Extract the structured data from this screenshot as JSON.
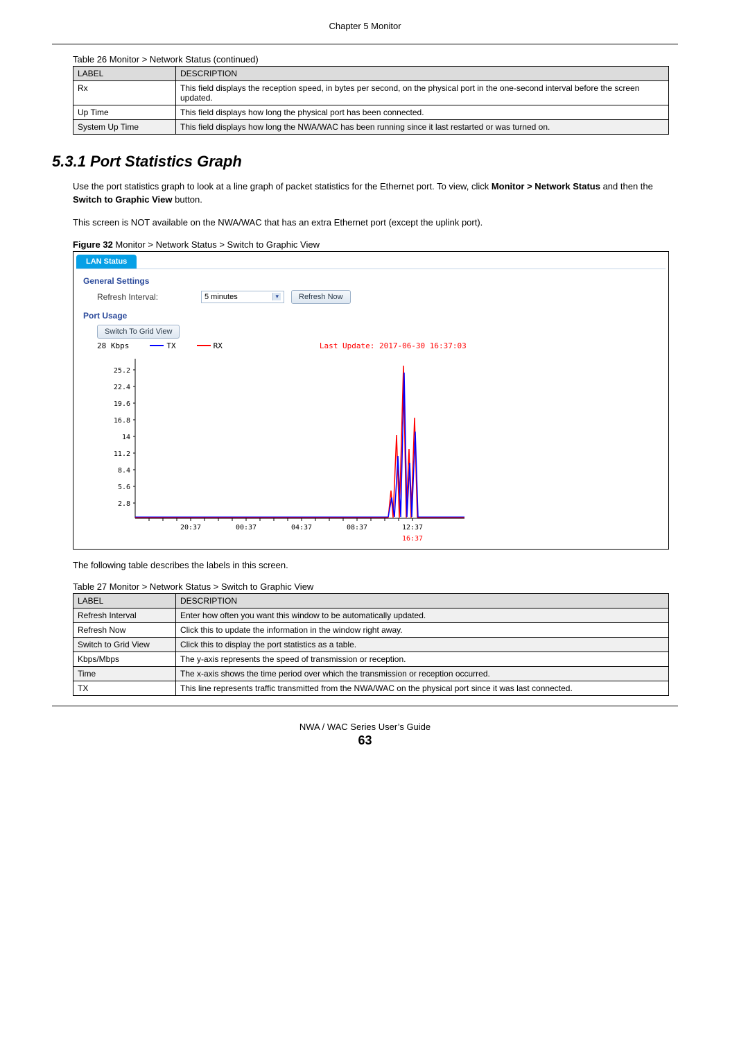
{
  "header": {
    "chapter": "Chapter 5 Monitor"
  },
  "table26": {
    "caption": "Table 26   Monitor > Network Status (continued)",
    "head_label": "LABEL",
    "head_desc": "DESCRIPTION",
    "rows": [
      {
        "label": "Rx",
        "desc": "This field displays the reception speed, in bytes per second, on the physical port in the one-second interval before the screen updated."
      },
      {
        "label": "Up Time",
        "desc": "This field displays how long the physical port has been connected."
      },
      {
        "label": "System Up Time",
        "desc": "This field displays how long the NWA/WAC has been running since it last restarted or was turned on."
      }
    ]
  },
  "section": {
    "title": "5.3.1  Port Statistics Graph",
    "para1_a": "Use the port statistics graph to look at a line graph of packet statistics for the Ethernet port. To view, click ",
    "para1_b": "Monitor > Network Status",
    "para1_c": " and then the ",
    "para1_d": "Switch to Graphic View",
    "para1_e": " button.",
    "para2": "This screen is NOT available on the NWA/WAC that has an extra Ethernet port (except the uplink port).",
    "fig_caption_bold": "Figure 32",
    "fig_caption_rest": "   Monitor > Network Status > Switch to Graphic View",
    "after_fig": "The following table describes the labels in this screen."
  },
  "figure": {
    "tab": "LAN Status",
    "general_settings": "General Settings",
    "refresh_interval_label": "Refresh Interval:",
    "refresh_interval_value": "5 minutes",
    "refresh_now": "Refresh Now",
    "port_usage": "Port Usage",
    "switch_grid": "Switch To Grid View",
    "y_unit": "28  Kbps",
    "legend_tx": "TX",
    "legend_rx": "RX",
    "last_update": "Last Update: 2017-06-30 16:37:03"
  },
  "chart_data": {
    "type": "line",
    "title": "",
    "xlabel": "",
    "ylabel": "Kbps",
    "ylim": [
      0,
      28
    ],
    "y_ticks": [
      2.8,
      5.6,
      8.4,
      11.2,
      14.0,
      16.8,
      19.6,
      22.4,
      25.2
    ],
    "x_ticks": [
      "20:37",
      "00:37",
      "04:37",
      "08:37",
      "12:37",
      "16:37"
    ],
    "series": [
      {
        "name": "TX",
        "color": "#0000ff"
      },
      {
        "name": "RX",
        "color": "#ff0000"
      }
    ],
    "note": "Traffic is ~0 for most of the period with brief spikes near 12:37 reaching up to ~25–28 Kbps on both TX and RX."
  },
  "table27": {
    "caption": "Table 27   Monitor > Network Status > Switch to Graphic View",
    "head_label": "LABEL",
    "head_desc": "DESCRIPTION",
    "rows": [
      {
        "label": "Refresh Interval",
        "desc": "Enter how often you want this window to be automatically updated."
      },
      {
        "label": "Refresh Now",
        "desc": "Click this to update the information in the window right away."
      },
      {
        "label": "Switch to Grid View",
        "desc": "Click this to display the port statistics as a table."
      },
      {
        "label": "Kbps/Mbps",
        "desc": "The y-axis represents the speed of transmission or reception."
      },
      {
        "label": "Time",
        "desc": "The x-axis shows the time period over which the transmission or reception occurred."
      },
      {
        "label": "TX",
        "desc": "This line represents traffic transmitted from the NWA/WAC on the physical port since it was last connected."
      }
    ]
  },
  "footer": {
    "guide": "NWA / WAC Series User’s Guide",
    "page": "63"
  }
}
